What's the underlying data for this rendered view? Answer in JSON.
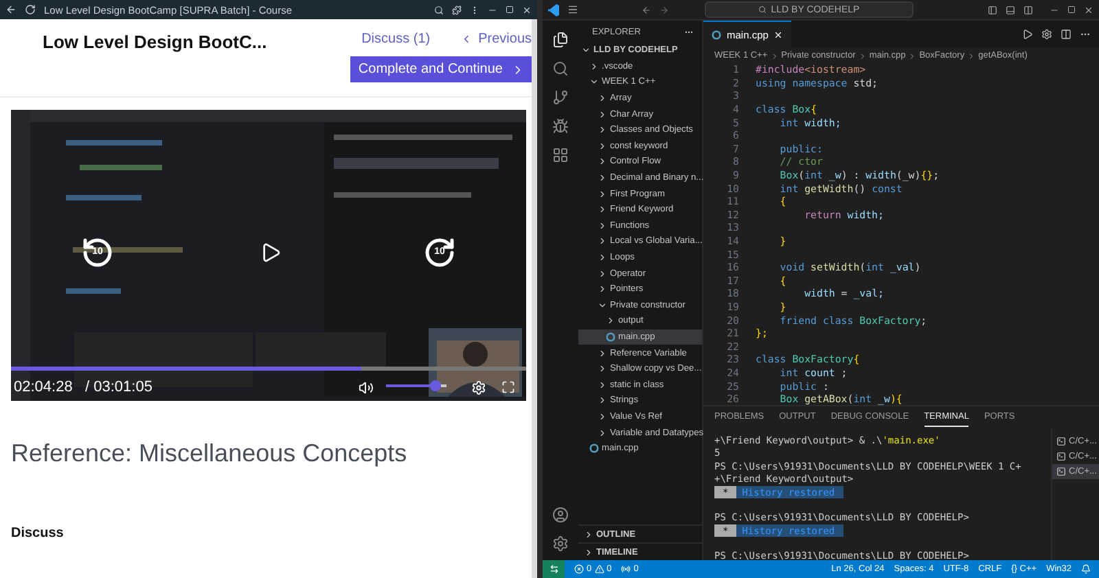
{
  "browser": {
    "title": "Low Level Design BootCamp [SUPRA Batch] - Course"
  },
  "course": {
    "title": "Low Level Design BootC...",
    "discuss_link": "Discuss (1)",
    "previous_link": "Previous",
    "complete_button": "Complete and Continue"
  },
  "video": {
    "kind": "picture",
    "skip_back": "10",
    "skip_forward": "10",
    "progress": {
      "level": 0.68
    },
    "elapsed": "02:04:28",
    "duration": "/ 03:01:05",
    "volume": {
      "level": 0.9
    }
  },
  "lesson": {
    "title": "Reference: Miscellaneous Concepts",
    "discuss_heading": "Discuss"
  },
  "editor_window": {
    "search": "LLD BY CODEHELP",
    "explorer": {
      "title": "EXPLORER",
      "tree": [
        {
          "label": "LLD BY CODEHELP",
          "kind": "root",
          "expanded": true,
          "selected": false,
          "children": [
            {
              "label": ".vscode",
              "kind": "folder",
              "expanded": false,
              "selected": false
            },
            {
              "label": "WEEK 1 C++",
              "kind": "folder",
              "expanded": true,
              "selected": false,
              "children": [
                {
                  "label": "Array",
                  "kind": "folder",
                  "expanded": false,
                  "selected": false
                },
                {
                  "label": "Char Array",
                  "kind": "folder",
                  "expanded": false,
                  "selected": false
                },
                {
                  "label": "Classes and Objects",
                  "kind": "folder",
                  "expanded": false,
                  "selected": false
                },
                {
                  "label": "const keyword",
                  "kind": "folder",
                  "expanded": false,
                  "selected": false
                },
                {
                  "label": "Control Flow",
                  "kind": "folder",
                  "expanded": false,
                  "selected": false
                },
                {
                  "label": "Decimal and Binary n...",
                  "kind": "folder",
                  "expanded": false,
                  "selected": false
                },
                {
                  "label": "First Program",
                  "kind": "folder",
                  "expanded": false,
                  "selected": false
                },
                {
                  "label": "Friend Keyword",
                  "kind": "folder",
                  "expanded": false,
                  "selected": false
                },
                {
                  "label": "Functions",
                  "kind": "folder",
                  "expanded": false,
                  "selected": false
                },
                {
                  "label": "Local vs Global Varia...",
                  "kind": "folder",
                  "expanded": false,
                  "selected": false
                },
                {
                  "label": "Loops",
                  "kind": "folder",
                  "expanded": false,
                  "selected": false
                },
                {
                  "label": "Operator",
                  "kind": "folder",
                  "expanded": false,
                  "selected": false
                },
                {
                  "label": "Pointers",
                  "kind": "folder",
                  "expanded": false,
                  "selected": false
                },
                {
                  "label": "Private constructor",
                  "kind": "folder",
                  "expanded": true,
                  "selected": false,
                  "children": [
                    {
                      "label": "output",
                      "kind": "folder",
                      "expanded": false,
                      "selected": false
                    },
                    {
                      "label": "main.cpp",
                      "kind": "file",
                      "selected": true
                    }
                  ]
                },
                {
                  "label": "Reference Variable",
                  "kind": "folder",
                  "expanded": false,
                  "selected": false
                },
                {
                  "label": "Shallow copy vs Dee...",
                  "kind": "folder",
                  "expanded": false,
                  "selected": false
                },
                {
                  "label": "static in class",
                  "kind": "folder",
                  "expanded": false,
                  "selected": false
                },
                {
                  "label": "Strings",
                  "kind": "folder",
                  "expanded": false,
                  "selected": false
                },
                {
                  "label": "Value Vs Ref",
                  "kind": "folder",
                  "expanded": false,
                  "selected": false
                },
                {
                  "label": "Variable and Datatypes",
                  "kind": "folder",
                  "expanded": false,
                  "selected": false
                }
              ]
            },
            {
              "label": "main.cpp",
              "kind": "file",
              "selected": false
            }
          ]
        }
      ],
      "sections": [
        "OUTLINE",
        "TIMELINE"
      ]
    },
    "tabs": [
      {
        "label": "main.cpp",
        "selected": true
      }
    ],
    "breadcrumb": [
      "WEEK 1 C++",
      "Private constructor",
      "main.cpp",
      "BoxFactory",
      "getABox(int)"
    ],
    "code": [
      {
        "number": "1",
        "tokens": [
          {
            "text": "#include",
            "kind": "pre"
          },
          {
            "text": "<iostream>",
            "kind": "str"
          }
        ]
      },
      {
        "number": "2",
        "tokens": [
          {
            "text": "using namespace",
            "kind": "kw"
          },
          {
            "text": " std;",
            "kind": "plain"
          }
        ]
      },
      {
        "number": "3"
      },
      {
        "number": "4",
        "tokens": [
          {
            "text": "class",
            "kind": "kw"
          },
          {
            "text": " Box",
            "kind": "type"
          },
          {
            "text": "{",
            "kind": "bracket"
          }
        ]
      },
      {
        "number": "5",
        "tokens": [
          {
            "text": "    int",
            "kind": "kw"
          },
          {
            "text": " width;",
            "kind": "var"
          }
        ]
      },
      {
        "number": "6"
      },
      {
        "number": "7",
        "tokens": [
          {
            "text": "    public:",
            "kind": "kw"
          }
        ]
      },
      {
        "number": "8",
        "tokens": [
          {
            "text": "    // ctor",
            "kind": "comment"
          }
        ]
      },
      {
        "number": "9",
        "tokens": [
          {
            "text": "    Box",
            "kind": "type"
          },
          {
            "text": "(",
            "kind": "plain"
          },
          {
            "text": "int",
            "kind": "kw"
          },
          {
            "text": " _w",
            "kind": "var"
          },
          {
            "text": ") : ",
            "kind": "plain"
          },
          {
            "text": "width",
            "kind": "var"
          },
          {
            "text": "(_w)",
            "kind": "plain"
          },
          {
            "text": "{}",
            "kind": "bracket"
          },
          {
            "text": ";",
            "kind": "plain"
          }
        ]
      },
      {
        "number": "10",
        "tokens": [
          {
            "text": "    int",
            "kind": "kw"
          },
          {
            "text": " getWidth",
            "kind": "fn"
          },
          {
            "text": "() ",
            "kind": "plain"
          },
          {
            "text": "const",
            "kind": "kw"
          }
        ]
      },
      {
        "number": "11",
        "tokens": [
          {
            "text": "    {",
            "kind": "bracket"
          }
        ]
      },
      {
        "number": "12",
        "tokens": [
          {
            "text": "        return",
            "kind": "pre"
          },
          {
            "text": " width;",
            "kind": "var"
          }
        ]
      },
      {
        "number": "13"
      },
      {
        "number": "14",
        "tokens": [
          {
            "text": "    }",
            "kind": "bracket"
          }
        ]
      },
      {
        "number": "15"
      },
      {
        "number": "16",
        "tokens": [
          {
            "text": "    void",
            "kind": "kw"
          },
          {
            "text": " setWidth",
            "kind": "fn"
          },
          {
            "text": "(",
            "kind": "plain"
          },
          {
            "text": "int",
            "kind": "kw"
          },
          {
            "text": " _val",
            "kind": "var"
          },
          {
            "text": ")",
            "kind": "plain"
          }
        ]
      },
      {
        "number": "17",
        "tokens": [
          {
            "text": "    {",
            "kind": "bracket"
          }
        ]
      },
      {
        "number": "18",
        "tokens": [
          {
            "text": "        width",
            "kind": "var"
          },
          {
            "text": " = ",
            "kind": "plain"
          },
          {
            "text": "_val;",
            "kind": "var"
          }
        ]
      },
      {
        "number": "19",
        "tokens": [
          {
            "text": "    }",
            "kind": "bracket"
          }
        ]
      },
      {
        "number": "20",
        "tokens": [
          {
            "text": "    friend class",
            "kind": "kw"
          },
          {
            "text": " BoxFactory",
            "kind": "type"
          },
          {
            "text": ";",
            "kind": "plain"
          }
        ]
      },
      {
        "number": "21",
        "tokens": [
          {
            "text": "};",
            "kind": "bracket"
          }
        ]
      },
      {
        "number": "22"
      },
      {
        "number": "23",
        "tokens": [
          {
            "text": "class",
            "kind": "kw"
          },
          {
            "text": " BoxFactory",
            "kind": "type"
          },
          {
            "text": "{",
            "kind": "bracket"
          }
        ]
      },
      {
        "number": "24",
        "tokens": [
          {
            "text": "    int",
            "kind": "kw"
          },
          {
            "text": " count",
            "kind": "var"
          },
          {
            "text": " ;",
            "kind": "plain"
          }
        ]
      },
      {
        "number": "25",
        "tokens": [
          {
            "text": "    public",
            "kind": "kw"
          },
          {
            "text": " :",
            "kind": "plain"
          }
        ]
      },
      {
        "number": "26",
        "tokens": [
          {
            "text": "    Box",
            "kind": "type"
          },
          {
            "text": " getABox",
            "kind": "fn"
          },
          {
            "text": "(",
            "kind": "plain"
          },
          {
            "text": "int",
            "kind": "kw"
          },
          {
            "text": " _w",
            "kind": "var"
          },
          {
            "text": "){",
            "kind": "bracket"
          }
        ]
      }
    ],
    "panel": {
      "tabs": [
        {
          "label": "PROBLEMS",
          "selected": false
        },
        {
          "label": "OUTPUT",
          "selected": false
        },
        {
          "label": "DEBUG CONSOLE",
          "selected": false
        },
        {
          "label": "TERMINAL",
          "selected": true
        },
        {
          "label": "PORTS",
          "selected": false
        }
      ],
      "lines": [
        {
          "kind": "text",
          "segments": [
            {
              "text": "+\\Friend Keyword\\output> & .\\",
              "kind": "plain"
            },
            {
              "text": "'main.exe'",
              "kind": "str"
            }
          ]
        },
        {
          "kind": "text",
          "segments": [
            {
              "text": "5",
              "kind": "plain"
            }
          ]
        },
        {
          "kind": "text",
          "segments": [
            {
              "text": "PS C:\\Users\\91931\\Documents\\LLD BY CODEHELP\\WEEK 1 C+",
              "kind": "plain"
            }
          ]
        },
        {
          "kind": "text",
          "segments": [
            {
              "text": "+\\Friend Keyword\\output>",
              "kind": "plain"
            }
          ]
        },
        {
          "kind": "restored",
          "mark": "*",
          "text": "History restored"
        },
        {
          "kind": "text",
          "segments": [
            {
              "text": "PS C:\\Users\\91931\\Documents\\LLD BY CODEHELP>",
              "kind": "plain"
            }
          ]
        },
        {
          "kind": "restored",
          "mark": "*",
          "text": "History restored"
        },
        {
          "kind": "text",
          "segments": [
            {
              "text": "PS C:\\Users\\91931\\Documents\\LLD BY CODEHELP>",
              "kind": "plain"
            }
          ]
        }
      ],
      "terminals": [
        {
          "label": "C/C+...",
          "selected": false
        },
        {
          "label": "C/C+...",
          "selected": false
        },
        {
          "label": "C/C+...",
          "selected": true
        }
      ]
    },
    "status_bar": {
      "errors": "0",
      "warnings": "0",
      "ports": "0",
      "items": [
        "Ln 26, Col 24",
        "Spaces: 4",
        "UTF-8",
        "CRLF",
        "{} C++",
        "Win32"
      ]
    }
  }
}
